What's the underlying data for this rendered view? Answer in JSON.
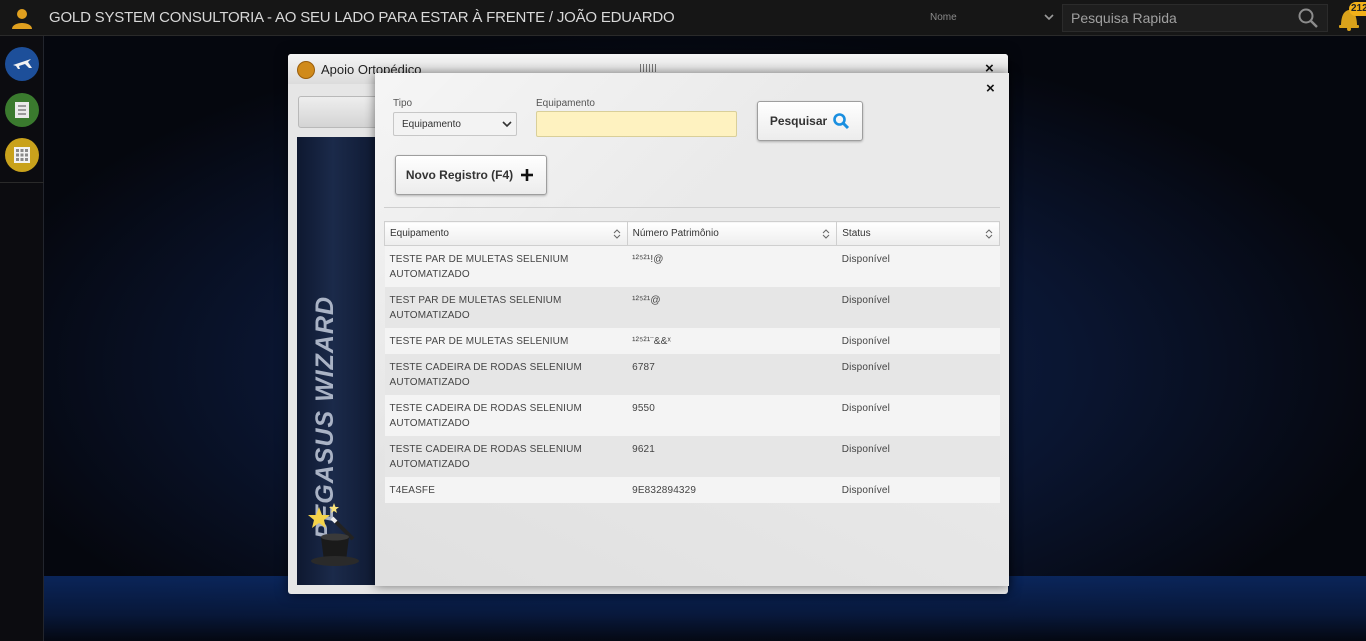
{
  "header": {
    "title": "GOLD SYSTEM CONSULTORIA - AO SEU LADO PARA ESTAR À FRENTE / JOÃO EDUARDO",
    "nome_select": "Nome",
    "search_placeholder": "Pesquisa Rapida",
    "notification_count": "2125"
  },
  "sidebar": {
    "items": [
      {
        "icon": "plane-icon",
        "color": "#1d4f9a"
      },
      {
        "icon": "list-icon",
        "color": "#3a7a2e"
      },
      {
        "icon": "calculator-icon",
        "color": "#c9a21c"
      }
    ]
  },
  "back_window": {
    "title": "Apoio Ortopédico",
    "close": "×",
    "wizard_text": "PEGASUS WIZARD"
  },
  "search_modal": {
    "close": "×",
    "tipo_label": "Tipo",
    "tipo_value": "Equipamento",
    "equipamento_label": "Equipamento",
    "equipamento_value": "",
    "search_button": "Pesquisar",
    "new_button": "Novo Registro (F4)",
    "columns": [
      "Equipamento",
      "Número Patrimônio",
      "Status"
    ],
    "rows": [
      {
        "equipamento": "TESTE PAR DE MULETAS SELENIUM AUTOMATIZADO",
        "patrimonio": "¹²⁵²¹!@",
        "status": "Disponível"
      },
      {
        "equipamento": "TEST PAR DE MULETAS SELENIUM AUTOMATIZADO",
        "patrimonio": "¹²⁵²¹@",
        "status": "Disponível"
      },
      {
        "equipamento": "TESTE PAR DE MULETAS SELENIUM",
        "patrimonio": "¹²⁵²¹¨&&ˣ",
        "status": "Disponível"
      },
      {
        "equipamento": "TESTE CADEIRA DE RODAS SELENIUM AUTOMATIZADO",
        "patrimonio": "6787",
        "status": "Disponível"
      },
      {
        "equipamento": "TESTE CADEIRA DE RODAS SELENIUM AUTOMATIZADO",
        "patrimonio": "9550",
        "status": "Disponível"
      },
      {
        "equipamento": "TESTE CADEIRA DE RODAS SELENIUM AUTOMATIZADO",
        "patrimonio": "9621",
        "status": "Disponível"
      },
      {
        "equipamento": "T4EASFE",
        "patrimonio": "9E832894329",
        "status": "Disponível"
      }
    ]
  },
  "colors": {
    "accent_blue": "#1a8fe0",
    "input_yellow": "#fef2c0",
    "badge": "#f2b118"
  }
}
